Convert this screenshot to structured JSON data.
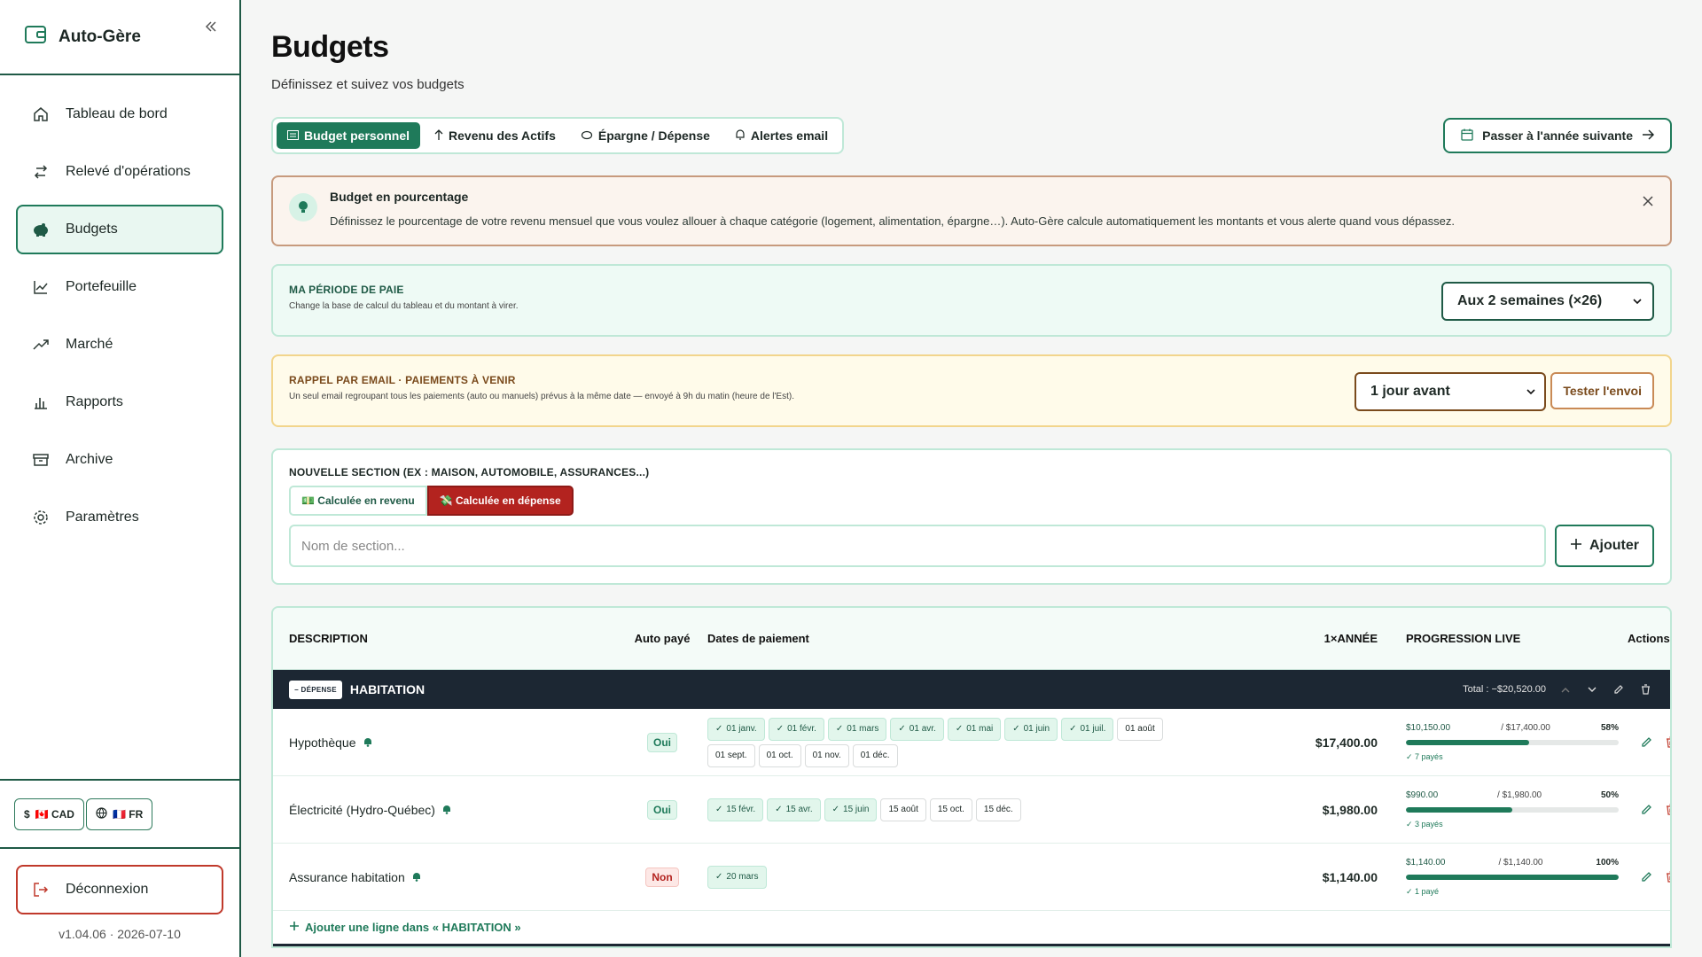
{
  "sidebar": {
    "brand": "Auto-Gère",
    "items": [
      {
        "label": "Tableau de bord",
        "icon": "home-icon"
      },
      {
        "label": "Relevé d'opérations",
        "icon": "swap-icon"
      },
      {
        "label": "Budgets",
        "icon": "piggy-bank-icon",
        "active": true
      },
      {
        "label": "Portefeuille",
        "icon": "line-chart-icon"
      },
      {
        "label": "Marché",
        "icon": "trending-up-icon"
      },
      {
        "label": "Rapports",
        "icon": "bar-chart-icon"
      },
      {
        "label": "Archive",
        "icon": "archive-icon"
      },
      {
        "label": "Paramètres",
        "icon": "gear-icon"
      }
    ],
    "currency": "🇨🇦 CAD",
    "language": "🇫🇷 FR",
    "logout": "Déconnexion",
    "version": "v1.04.06 · 2026-07-10"
  },
  "header": {
    "title": "Budgets",
    "subtitle": "Définissez et suivez vos budgets"
  },
  "tabs": [
    {
      "label": "Budget personnel",
      "active": true
    },
    {
      "label": "Revenu des Actifs"
    },
    {
      "label": "Épargne / Dépense"
    },
    {
      "label": "Alertes email"
    }
  ],
  "next_year_button": "Passer à l'année suivante",
  "info": {
    "title": "Budget en pourcentage",
    "text": "Définissez le pourcentage de votre revenu mensuel que vous voulez allouer à chaque catégorie (logement, alimentation, épargne…). Auto-Gère calcule automatiquement les montants et vous alerte quand vous dépassez."
  },
  "pay_period": {
    "label": "MA PÉRIODE DE PAIE",
    "help": "Change la base de calcul du tableau et du montant à virer.",
    "selected": "Aux 2 semaines (×26)"
  },
  "reminder": {
    "label": "RAPPEL PAR EMAIL · PAIEMENTS À VENIR",
    "help": "Un seul email regroupant tous les paiements (auto ou manuels) prévus à la même date — envoyé à 9h du matin (heure de l'Est).",
    "selected": "1 jour avant",
    "test_button": "Tester l'envoi"
  },
  "new_section": {
    "label": "NOUVELLE SECTION (EX : MAISON, AUTOMOBILE, ASSURANCES...)",
    "income_toggle": "💵 Calculée en revenu",
    "expense_toggle": "💸 Calculée en dépense",
    "placeholder": "Nom de section...",
    "add_button": "Ajouter"
  },
  "table": {
    "headers": {
      "description": "DESCRIPTION",
      "auto_paid": "Auto payé",
      "dates": "Dates de paiement",
      "year": "1×ANNÉE",
      "progress": "PROGRESSION LIVE",
      "actions": "Actions"
    },
    "group": {
      "type": "− DÉPENSE",
      "name": "HABITATION",
      "total": "Total : −$20,520.00"
    },
    "rows": [
      {
        "description": "Hypothèque",
        "auto": "Oui",
        "dates_paid": [
          "01 janv.",
          "01 févr.",
          "01 mars",
          "01 avr.",
          "01 mai",
          "01 juin",
          "01 juil."
        ],
        "dates_unpaid": [
          "01 août",
          "01 sept.",
          "01 oct.",
          "01 nov.",
          "01 déc."
        ],
        "amount": "$17,400.00",
        "progress_paid": "$10,150.00",
        "progress_max": "/ $17,400.00",
        "progress_pct": "58%",
        "progress_value": 58,
        "paid_count": "✓ 7 payés"
      },
      {
        "description": "Électricité (Hydro-Québec)",
        "auto": "Oui",
        "dates_paid": [
          "15 févr.",
          "15 avr.",
          "15 juin"
        ],
        "dates_unpaid": [
          "15 août",
          "15 oct.",
          "15 déc."
        ],
        "amount": "$1,980.00",
        "progress_paid": "$990.00",
        "progress_max": "/ $1,980.00",
        "progress_pct": "50%",
        "progress_value": 50,
        "paid_count": "✓ 3 payés"
      },
      {
        "description": "Assurance habitation",
        "auto": "Non",
        "dates_paid": [
          "20 mars"
        ],
        "dates_unpaid": [],
        "amount": "$1,140.00",
        "progress_paid": "$1,140.00",
        "progress_max": "/ $1,140.00",
        "progress_pct": "100%",
        "progress_value": 100,
        "paid_count": "✓ 1 payé"
      }
    ],
    "add_line": "Ajouter une ligne dans « HABITATION »"
  },
  "colors": {
    "accent": "#1f7a5a",
    "danger": "#b3231f",
    "dark": "#1c2733"
  }
}
